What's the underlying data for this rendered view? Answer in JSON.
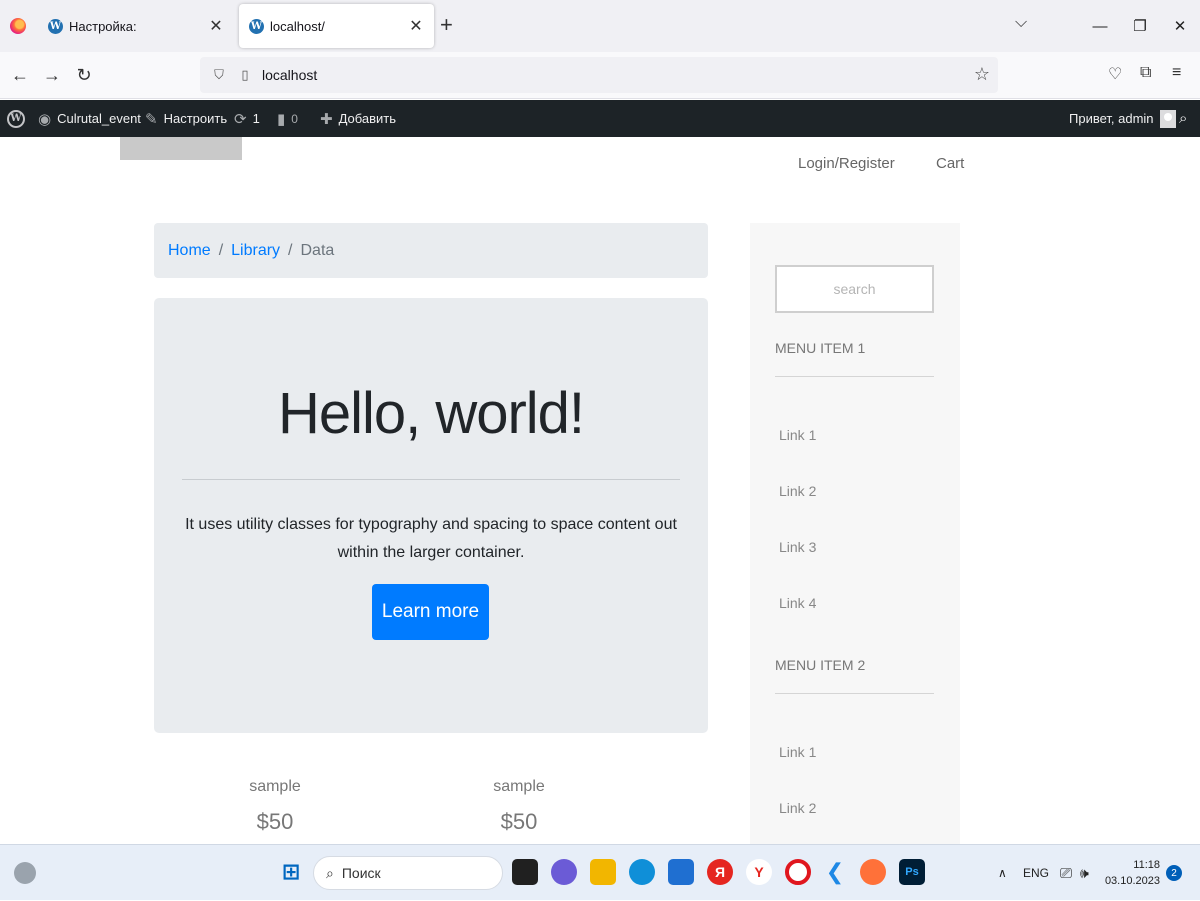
{
  "browser": {
    "tabs": [
      {
        "title": "Настройка:",
        "active": false
      },
      {
        "title": "localhost/",
        "active": true
      }
    ],
    "new_tab": "+",
    "url": "localhost"
  },
  "adminbar": {
    "site_name": "Culrutal_event",
    "customize": "Настроить",
    "updates_count": "1",
    "comments_count": "0",
    "add_new": "Добавить",
    "greeting": "Привет, admin"
  },
  "header": {
    "login": "Login/Register",
    "cart": "Cart"
  },
  "breadcrumb": {
    "home": "Home",
    "library": "Library",
    "current": "Data",
    "separator": "/"
  },
  "jumbotron": {
    "title": "Hello, world!",
    "text": "It uses utility classes for typography and spacing to space content out within the larger container.",
    "button": "Learn more"
  },
  "products": [
    {
      "name": "sample",
      "price": "$50"
    },
    {
      "name": "sample",
      "price": "$50"
    }
  ],
  "sidebar": {
    "search_placeholder": "search",
    "menus": [
      {
        "title": "MENU ITEM 1",
        "links": [
          "Link 1",
          "Link 2",
          "Link 3",
          "Link 4"
        ]
      },
      {
        "title": "MENU ITEM 2",
        "links": [
          "Link 1",
          "Link 2"
        ]
      }
    ]
  },
  "taskbar": {
    "search": "Поиск",
    "lang": "ENG",
    "time": "11:18",
    "date": "03.10.2023",
    "notifications": "2"
  },
  "colors": {
    "primary": "#007bff",
    "adminbar_bg": "#1d2327",
    "jumbotron_bg": "#e9ecef",
    "sidebar_bg": "#f7f7f7"
  }
}
